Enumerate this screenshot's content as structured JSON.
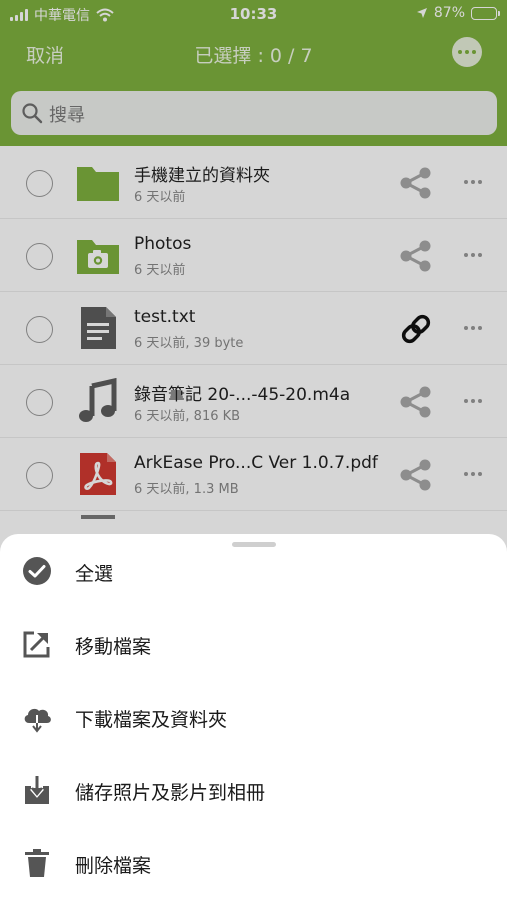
{
  "status_bar": {
    "carrier": "中華電信",
    "time": "10:33",
    "battery": "87%",
    "battery_level": 0.87
  },
  "nav": {
    "cancel_label": "取消",
    "title": "已選擇 : 0 / 7",
    "more_icon": "more-horizontal-icon"
  },
  "search": {
    "placeholder": "搜尋",
    "icon": "search-icon"
  },
  "files": [
    {
      "name": "手機建立的資料夾",
      "meta": "6 天以前",
      "icon": "folder-icon",
      "action_icon": "share-icon"
    },
    {
      "name": "Photos",
      "meta": "6 天以前",
      "icon": "photo-folder-icon",
      "action_icon": "share-icon"
    },
    {
      "name": " test.txt",
      "meta": "6 天以前, 39 byte",
      "icon": "text-file-icon",
      "action_icon": "link-icon"
    },
    {
      "name": "錄音筆記 20-...-45-20.m4a",
      "meta": "6 天以前, 816 KB",
      "icon": "audio-file-icon",
      "action_icon": "share-icon"
    },
    {
      "name": "ArkEase Pro...C Ver 1.0.7.pdf",
      "meta": "6 天以前, 1.3 MB",
      "icon": "pdf-file-icon",
      "action_icon": "share-icon"
    }
  ],
  "actions": [
    {
      "label": "全選",
      "icon": "check-circle-icon"
    },
    {
      "label": "移動檔案",
      "icon": "move-icon"
    },
    {
      "label": "下載檔案及資料夾",
      "icon": "cloud-download-icon"
    },
    {
      "label": "儲存照片及影片到相冊",
      "icon": "save-to-album-icon"
    },
    {
      "label": "刪除檔案",
      "icon": "trash-icon"
    }
  ],
  "colors": {
    "brand_green": "#7fb13e",
    "pdf_red": "#d23a32",
    "icon_gray": "#555555"
  }
}
